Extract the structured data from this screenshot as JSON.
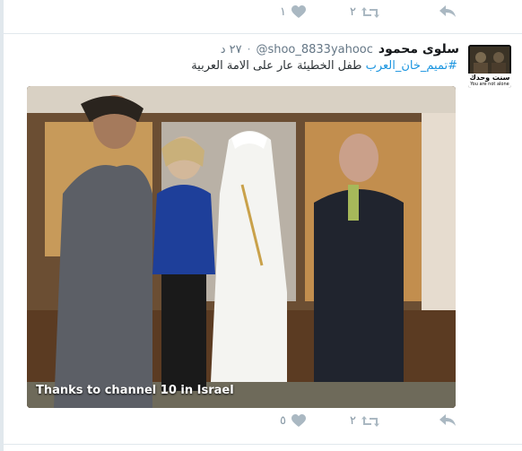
{
  "top_actions": {
    "like_count": "١",
    "retweet_count": "٢"
  },
  "tweet": {
    "display_name": "سلوى محمود",
    "handle": "@shoo_8833yahooc",
    "time": "٢٧ د",
    "hashtag": "#تميم_خان_العرب",
    "text_body": " طفل الخطيئة عار على الامة العربية",
    "avatar_caption": "سنت وحدك",
    "avatar_subcaption": "You are not alone",
    "video_caption": "Thanks to channel 10 in Israel",
    "like_count": "٥",
    "retweet_count": "٢"
  },
  "icons": [
    "heart-icon",
    "retweet-icon",
    "reply-icon"
  ],
  "colors": {
    "icon_gray": "#8899a6",
    "link_blue": "#1b95e0",
    "divider": "#e1e8ed"
  }
}
